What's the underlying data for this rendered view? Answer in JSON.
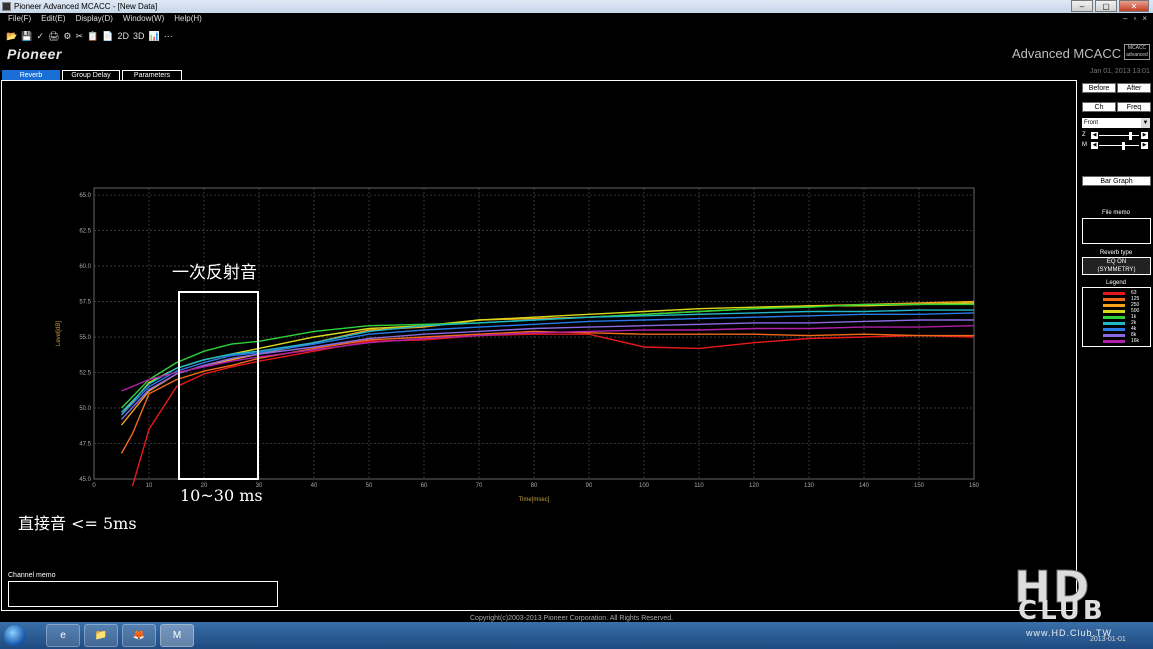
{
  "window": {
    "title": "Pioneer Advanced MCACC - [New Data]",
    "controls": [
      "–",
      "▢",
      "✕"
    ]
  },
  "menu": {
    "items": [
      "File(F)",
      "Edit(E)",
      "Display(D)",
      "Window(W)",
      "Help(H)"
    ],
    "mdi_controls": [
      "–",
      "▫",
      "×"
    ]
  },
  "toolbar": {
    "items": [
      "📂",
      "💾",
      "✓",
      "🖨",
      "⚙",
      "✂",
      "📋",
      "📄",
      "2D",
      "3D",
      "📊",
      "⋯"
    ]
  },
  "header": {
    "logo": "Pioneer",
    "app_title": "Advanced MCACC",
    "badge": "MCACC advanced",
    "date": "Jan 01, 2013 13:01"
  },
  "tabs": [
    {
      "label": "Reverb",
      "active": true
    },
    {
      "label": "Group Delay",
      "active": false
    },
    {
      "label": "Parameters",
      "active": false
    }
  ],
  "right_panel": {
    "before_label": "Before",
    "after_label": "After",
    "ch_label": "Ch",
    "freq_label": "Freq",
    "select_value": "Front",
    "z_label": "Z",
    "m_label": "M",
    "bar_graph_label": "Bar Graph",
    "file_memo_label": "File memo",
    "eq_header": "Reverb type",
    "eq_value_line1": "EQ ON",
    "eq_value_line2": "(SYMMETRY)",
    "legend_title": "Legend",
    "legend": [
      {
        "label": "63",
        "color": "#e8191a"
      },
      {
        "label": "125",
        "color": "#f06a1a"
      },
      {
        "label": "250",
        "color": "#f5a31a"
      },
      {
        "label": "500",
        "color": "#d8d81a"
      },
      {
        "label": "1k",
        "color": "#2ed43a"
      },
      {
        "label": "2k",
        "color": "#20b8c8"
      },
      {
        "label": "4k",
        "color": "#2a7ae8"
      },
      {
        "label": "8k",
        "color": "#8a6ae0"
      },
      {
        "label": "16k",
        "color": "#b020a8"
      }
    ]
  },
  "annotations": {
    "first_reflection": "一次反射音",
    "range": "10~30 ms",
    "direct": "直接音 <= 5ms"
  },
  "channel_memo_label": "Channel memo",
  "copyright": "Copyright(c)2003-2013 Pioneer Corporation. All Rights Reserved.",
  "clock": "2013-01-01",
  "watermark": {
    "logo": "HD",
    "sub": "CLUB",
    "url": "www.HD.Club.TW"
  },
  "taskbar": {
    "apps": [
      "e",
      "📁",
      "🦊",
      "M"
    ]
  },
  "chart_data": {
    "type": "line",
    "title": "",
    "xlabel": "Time[msec]",
    "ylabel": "Level[dB]",
    "xlim": [
      0,
      160
    ],
    "ylim": [
      45.0,
      65.5
    ],
    "xticks": [
      0,
      10,
      20,
      30,
      40,
      50,
      60,
      70,
      80,
      90,
      100,
      110,
      120,
      130,
      140,
      150,
      160
    ],
    "yticks": [
      45.0,
      47.5,
      50.0,
      52.5,
      55.0,
      57.5,
      60.0,
      62.5,
      65.0
    ],
    "ytick_labels": [
      "45.0",
      "47.5",
      "50.0",
      "52.5",
      "55.0",
      "57.5",
      "60.0",
      "62.5",
      "65.0"
    ],
    "xtick_labels": [
      "0",
      "10",
      "20",
      "30",
      "40",
      "50",
      "60",
      "70",
      "80",
      "90",
      "100",
      "110",
      "120",
      "130",
      "140",
      "150",
      "160"
    ],
    "grid": true,
    "series": [
      {
        "name": "63",
        "color": "#e8191a",
        "x": [
          7,
          10,
          15,
          20,
          25,
          30,
          40,
          50,
          60,
          70,
          80,
          90,
          100,
          110,
          120,
          130,
          140,
          150,
          160
        ],
        "y": [
          44.5,
          48.5,
          51.5,
          52.4,
          52.9,
          53.3,
          54.0,
          54.7,
          54.8,
          55.1,
          55.2,
          55.2,
          54.3,
          54.2,
          54.6,
          54.9,
          55.0,
          55.1,
          55.0
        ]
      },
      {
        "name": "125",
        "color": "#f06a1a",
        "x": [
          5,
          7,
          10,
          15,
          20,
          25,
          30,
          40,
          50,
          60,
          70,
          80,
          90,
          100,
          110,
          120,
          130,
          140,
          150,
          160
        ],
        "y": [
          46.8,
          48.2,
          51.0,
          52.0,
          52.6,
          53.0,
          53.5,
          54.2,
          54.8,
          55.0,
          55.2,
          55.4,
          55.3,
          55.2,
          55.2,
          55.2,
          55.1,
          55.2,
          55.1,
          55.1
        ]
      },
      {
        "name": "250",
        "color": "#f5a31a",
        "x": [
          5,
          10,
          15,
          20,
          25,
          30,
          40,
          50,
          60,
          70,
          80,
          90,
          100,
          110,
          120,
          130,
          140,
          150,
          160
        ],
        "y": [
          48.8,
          51.2,
          52.4,
          53.0,
          53.4,
          53.8,
          54.6,
          55.5,
          55.7,
          56.2,
          56.3,
          56.4,
          56.6,
          56.8,
          57.0,
          57.2,
          57.3,
          57.4,
          57.5
        ]
      },
      {
        "name": "500",
        "color": "#d8d81a",
        "x": [
          5,
          10,
          15,
          20,
          25,
          30,
          40,
          50,
          60,
          70,
          80,
          90,
          100,
          110,
          120,
          130,
          140,
          150,
          160
        ],
        "y": [
          49.5,
          51.8,
          52.8,
          53.4,
          53.8,
          54.2,
          55.0,
          55.6,
          55.8,
          56.2,
          56.4,
          56.6,
          56.8,
          57.0,
          57.1,
          57.2,
          57.2,
          57.3,
          57.4
        ]
      },
      {
        "name": "1k",
        "color": "#2ed43a",
        "x": [
          5,
          10,
          15,
          20,
          25,
          30,
          40,
          50,
          60,
          70,
          80,
          90,
          100,
          110,
          120,
          130,
          140,
          150,
          160
        ],
        "y": [
          50.0,
          52.0,
          53.2,
          54.0,
          54.5,
          54.7,
          55.4,
          55.8,
          55.9,
          56.0,
          56.2,
          56.4,
          56.6,
          56.8,
          57.0,
          57.1,
          57.3,
          57.3,
          57.3
        ]
      },
      {
        "name": "2k",
        "color": "#20b8c8",
        "x": [
          5,
          10,
          15,
          20,
          25,
          30,
          40,
          50,
          60,
          70,
          80,
          90,
          100,
          110,
          120,
          130,
          140,
          150,
          160
        ],
        "y": [
          49.7,
          51.7,
          52.8,
          53.4,
          53.8,
          54.0,
          54.6,
          55.4,
          55.8,
          56.0,
          56.2,
          56.4,
          56.5,
          56.6,
          56.7,
          56.8,
          56.8,
          56.9,
          56.9
        ]
      },
      {
        "name": "4k",
        "color": "#2a7ae8",
        "x": [
          5,
          10,
          15,
          20,
          25,
          30,
          40,
          50,
          60,
          70,
          80,
          90,
          100,
          110,
          120,
          130,
          140,
          150,
          160
        ],
        "y": [
          49.5,
          51.5,
          52.6,
          53.2,
          53.7,
          53.9,
          54.5,
          55.2,
          55.5,
          55.7,
          55.9,
          56.1,
          56.2,
          56.3,
          56.4,
          56.5,
          56.6,
          56.6,
          56.7
        ]
      },
      {
        "name": "8k",
        "color": "#8a6ae0",
        "x": [
          5,
          10,
          15,
          20,
          25,
          30,
          40,
          50,
          60,
          70,
          80,
          90,
          100,
          110,
          120,
          130,
          140,
          150,
          160
        ],
        "y": [
          49.2,
          51.3,
          52.4,
          53.0,
          53.5,
          53.8,
          54.3,
          54.9,
          55.2,
          55.4,
          55.6,
          55.7,
          55.8,
          55.9,
          56.0,
          56.0,
          56.1,
          56.2,
          56.2
        ]
      },
      {
        "name": "16k",
        "color": "#b020a8",
        "x": [
          5,
          10,
          15,
          20,
          25,
          30,
          40,
          50,
          60,
          70,
          80,
          90,
          100,
          110,
          120,
          130,
          140,
          150,
          160
        ],
        "y": [
          51.2,
          52.0,
          52.5,
          52.9,
          53.3,
          53.6,
          54.1,
          54.6,
          54.9,
          55.1,
          55.3,
          55.4,
          55.5,
          55.5,
          55.6,
          55.6,
          55.7,
          55.7,
          55.8
        ]
      }
    ]
  }
}
